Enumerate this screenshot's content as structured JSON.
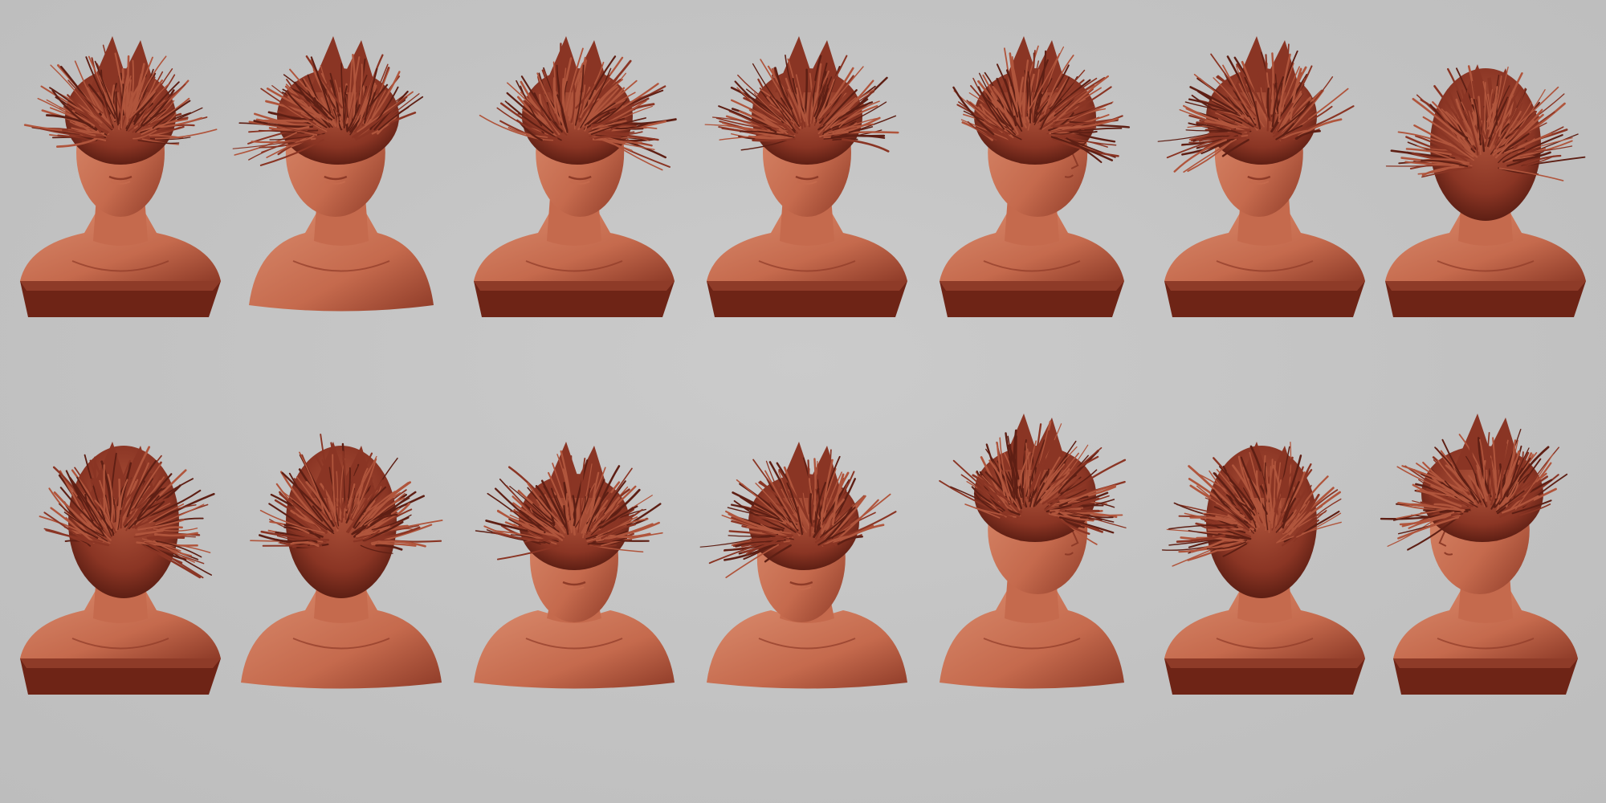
{
  "render": {
    "background_color": "#c4c4c4",
    "clay_colors": {
      "skin_light": "#d98a6c",
      "skin_mid": "#c56a4d",
      "skin_shadow": "#8e3b28",
      "hair": "#8a3524",
      "hair_dark": "#5e1f14",
      "hair_light": "#b0553c",
      "base_dark": "#6e2416"
    }
  },
  "rows": [
    {
      "views": [
        {
          "view": "front-tilt",
          "base": true
        },
        {
          "view": "side-left-down",
          "base": false
        },
        {
          "view": "three-quarter-right",
          "base": true
        },
        {
          "view": "front",
          "base": true
        },
        {
          "view": "profile-right",
          "base": true
        },
        {
          "view": "three-quarter-left",
          "base": true
        },
        {
          "view": "back-three-quarter",
          "base": true
        }
      ]
    },
    {
      "views": [
        {
          "view": "back-right",
          "base": true
        },
        {
          "view": "back",
          "base": false
        },
        {
          "view": "top-down-front",
          "base": false
        },
        {
          "view": "top-down-left",
          "base": false
        },
        {
          "view": "profile-right-tilt",
          "base": false
        },
        {
          "view": "back-left",
          "base": true
        },
        {
          "view": "profile-left",
          "base": true
        }
      ]
    }
  ]
}
